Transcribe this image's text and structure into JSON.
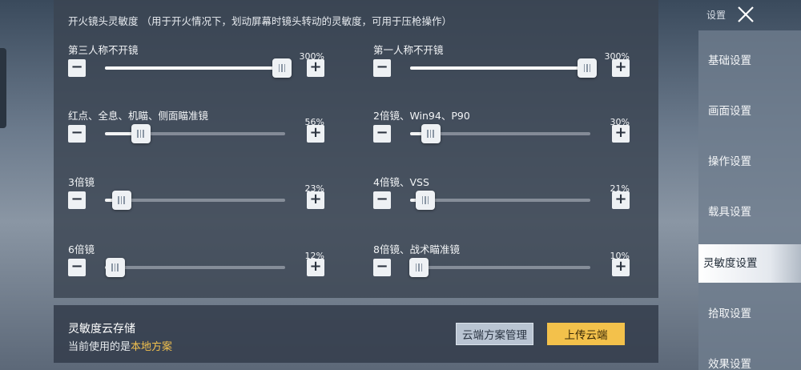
{
  "panel": {
    "title": "开火镜头灵敏度 （用于开火情况下，划动屏幕时镜头转动的灵敏度，可用于压枪操作）",
    "minus_label": "−",
    "plus_label": "+",
    "settings": [
      {
        "label": "第三人称不开镜",
        "value_text": "300%",
        "value": 300,
        "max": 300
      },
      {
        "label": "第一人称不开镜",
        "value_text": "300%",
        "value": 300,
        "max": 300
      },
      {
        "label": "红点、全息、机瞄、侧面瞄准镜",
        "value_text": "56%",
        "value": 56,
        "max": 300
      },
      {
        "label": "2倍镜、Win94、P90",
        "value_text": "30%",
        "value": 30,
        "max": 300
      },
      {
        "label": "3倍镜",
        "value_text": "23%",
        "value": 23,
        "max": 300
      },
      {
        "label": "4倍镜、VSS",
        "value_text": "21%",
        "value": 21,
        "max": 300
      },
      {
        "label": "6倍镜",
        "value_text": "12%",
        "value": 12,
        "max": 300
      },
      {
        "label": "8倍镜、战术瞄准镜",
        "value_text": "10%",
        "value": 10,
        "max": 300
      }
    ]
  },
  "cloud": {
    "title": "灵敏度云存储",
    "current_prefix": "当前使用的是",
    "current_plan": "本地方案",
    "manage_label": "云端方案管理",
    "upload_label": "上传云端"
  },
  "sidebar": {
    "title": "设置",
    "close_icon": "close-icon",
    "items": [
      {
        "label": "基础设置",
        "active": false
      },
      {
        "label": "画面设置",
        "active": false
      },
      {
        "label": "操作设置",
        "active": false
      },
      {
        "label": "载具设置",
        "active": false
      },
      {
        "label": "灵敏度设置",
        "active": true
      },
      {
        "label": "拾取设置",
        "active": false
      },
      {
        "label": "效果设置",
        "active": false
      }
    ]
  },
  "colors": {
    "accent_yellow": "#f3c14b",
    "highlight_text": "#f2c14e",
    "panel_bg": "#3a4452"
  }
}
